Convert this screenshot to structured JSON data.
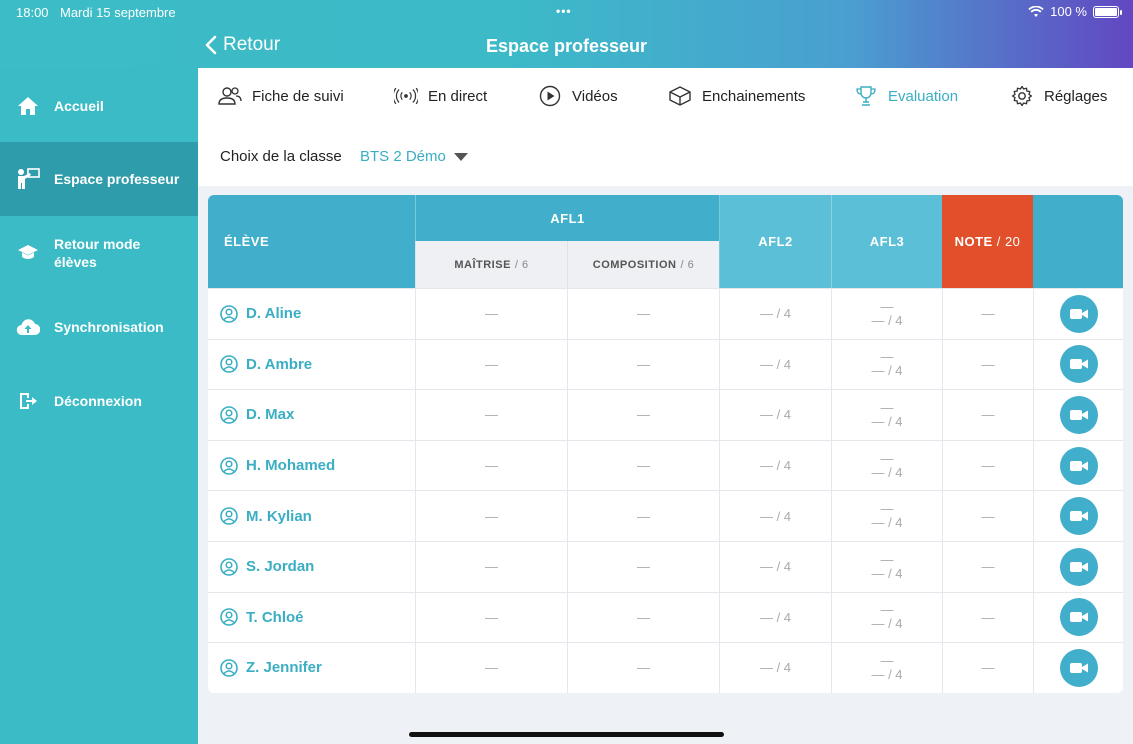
{
  "status": {
    "time": "18:00",
    "date": "Mardi 15 septembre",
    "dots": "•••",
    "battery": "100 %"
  },
  "header": {
    "back_label": "Retour",
    "title": "Espace professeur"
  },
  "sidebar": {
    "items": [
      {
        "label": "Accueil",
        "icon": "home-icon"
      },
      {
        "label": "Espace professeur",
        "icon": "teacher-icon",
        "active": true
      },
      {
        "label": "Retour mode élèves",
        "icon": "graduation-cap-icon"
      },
      {
        "label": "Synchronisation",
        "icon": "cloud-upload-icon"
      },
      {
        "label": "Déconnexion",
        "icon": "logout-icon"
      }
    ]
  },
  "tabs": [
    {
      "label": "Fiche de suivi",
      "icon": "users-icon"
    },
    {
      "label": "En direct",
      "icon": "broadcast-icon"
    },
    {
      "label": "Vidéos",
      "icon": "play-icon"
    },
    {
      "label": "Enchainements",
      "icon": "box-icon"
    },
    {
      "label": "Evaluation",
      "icon": "trophy-icon",
      "active": true
    },
    {
      "label": "Réglages",
      "icon": "gear-icon"
    }
  ],
  "class_choice": {
    "label": "Choix de la classe",
    "value": "BTS 2 Démo"
  },
  "table": {
    "headers": {
      "eleve": "ÉLÈVE",
      "afl1": "AFL1",
      "maitrise": "MAÎTRISE",
      "maitrise_max": "/ 6",
      "composition": "COMPOSITION",
      "composition_max": "/ 6",
      "afl2": "AFL2",
      "afl3": "AFL3",
      "note": "NOTE",
      "note_max": "/ 20"
    },
    "rows": [
      {
        "name": "D. Aline",
        "maitrise": "—",
        "composition": "—",
        "afl2": "— / 4",
        "afl3_top": "—",
        "afl3": "— / 4",
        "note": "—"
      },
      {
        "name": "D. Ambre",
        "maitrise": "—",
        "composition": "—",
        "afl2": "— / 4",
        "afl3_top": "—",
        "afl3": "— / 4",
        "note": "—"
      },
      {
        "name": "D. Max",
        "maitrise": "—",
        "composition": "—",
        "afl2": "— / 4",
        "afl3_top": "—",
        "afl3": "— / 4",
        "note": "—"
      },
      {
        "name": "H. Mohamed",
        "maitrise": "—",
        "composition": "—",
        "afl2": "— / 4",
        "afl3_top": "—",
        "afl3": "— / 4",
        "note": "—"
      },
      {
        "name": "M. Kylian",
        "maitrise": "—",
        "composition": "—",
        "afl2": "— / 4",
        "afl3_top": "—",
        "afl3": "— / 4",
        "note": "—"
      },
      {
        "name": "S. Jordan",
        "maitrise": "—",
        "composition": "—",
        "afl2": "— / 4",
        "afl3_top": "—",
        "afl3": "— / 4",
        "note": "—"
      },
      {
        "name": "T. Chloé",
        "maitrise": "—",
        "composition": "—",
        "afl2": "— / 4",
        "afl3_top": "—",
        "afl3": "— / 4",
        "note": "—"
      },
      {
        "name": "Z. Jennifer",
        "maitrise": "—",
        "composition": "—",
        "afl2": "— / 4",
        "afl3_top": "—",
        "afl3": "— / 4",
        "note": "—"
      }
    ]
  },
  "colors": {
    "accent": "#3bbbc6",
    "sidebar_active": "#2e9cab",
    "note_header": "#e1502a",
    "table_header": "#41aecb"
  }
}
